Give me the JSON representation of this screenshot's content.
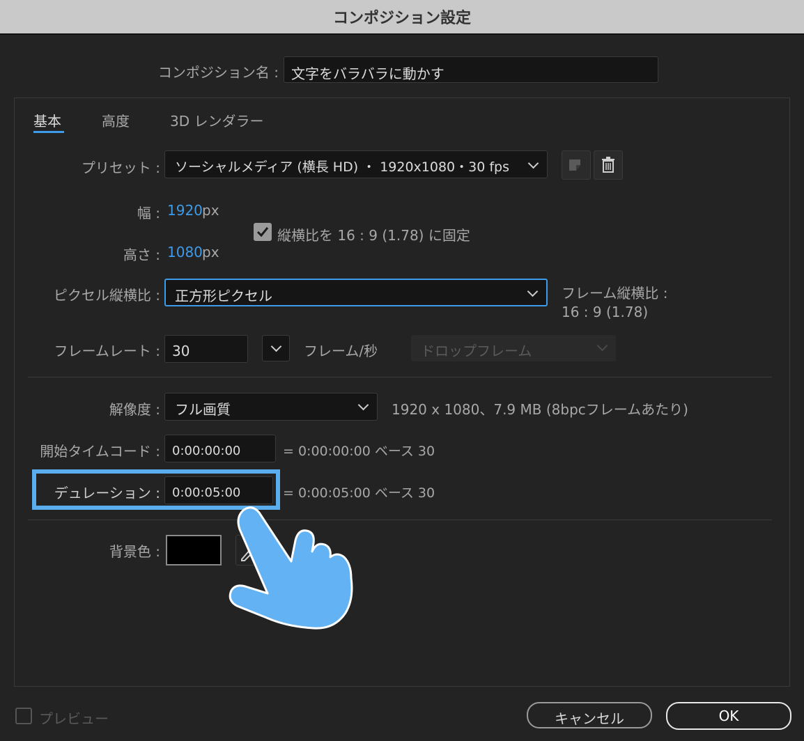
{
  "window": {
    "title": "コンポジション設定"
  },
  "comp_name": {
    "label": "コンポジション名 :",
    "value": "文字をバラバラに動かす"
  },
  "tabs": [
    {
      "label": "基本",
      "active": true
    },
    {
      "label": "高度",
      "active": false
    },
    {
      "label": "3D レンダラー",
      "active": false
    }
  ],
  "preset": {
    "label": "プリセット :",
    "value": "ソーシャルメディア (横長 HD) ・ 1920x1080・30 fps"
  },
  "width": {
    "label": "幅 :",
    "value": "1920",
    "unit": "px"
  },
  "height": {
    "label": "高さ :",
    "value": "1080",
    "unit": "px"
  },
  "lock_aspect": {
    "label": "縦横比を 16 : 9 (1.78) に固定",
    "checked": true
  },
  "pixel_aspect": {
    "label": "ピクセル縦横比 :",
    "value": "正方形ピクセル",
    "frame_aspect_label": "フレーム縦横比 :",
    "frame_aspect_value": "16 : 9 (1.78)"
  },
  "frame_rate": {
    "label": "フレームレート :",
    "value": "30",
    "unit": "フレーム/秒",
    "drop_frame": "ドロップフレーム"
  },
  "resolution": {
    "label": "解像度 :",
    "value": "フル画質",
    "info": "1920 x 1080、7.9 MB (8bpcフレームあたり)"
  },
  "start_timecode": {
    "label": "開始タイムコード :",
    "value": "0:00:00:00",
    "info": "= 0:00:00:00  ベース 30"
  },
  "duration": {
    "label": "デュレーション :",
    "value": "0:00:05:00",
    "info": "= 0:00:05:00  ベース 30"
  },
  "background": {
    "label": "背景色 :",
    "color": "#000000"
  },
  "footer": {
    "preview_label": "プレビュー",
    "cancel_label": "キャンセル",
    "ok_label": "OK"
  },
  "colors": {
    "accent": "#3d9be9",
    "highlight": "#5aaeee",
    "hand": "#63b3f4"
  },
  "icons": [
    "new-preset-icon",
    "trash-icon",
    "checkbox-checked-icon",
    "eyedropper-icon",
    "pointing-hand-icon"
  ]
}
